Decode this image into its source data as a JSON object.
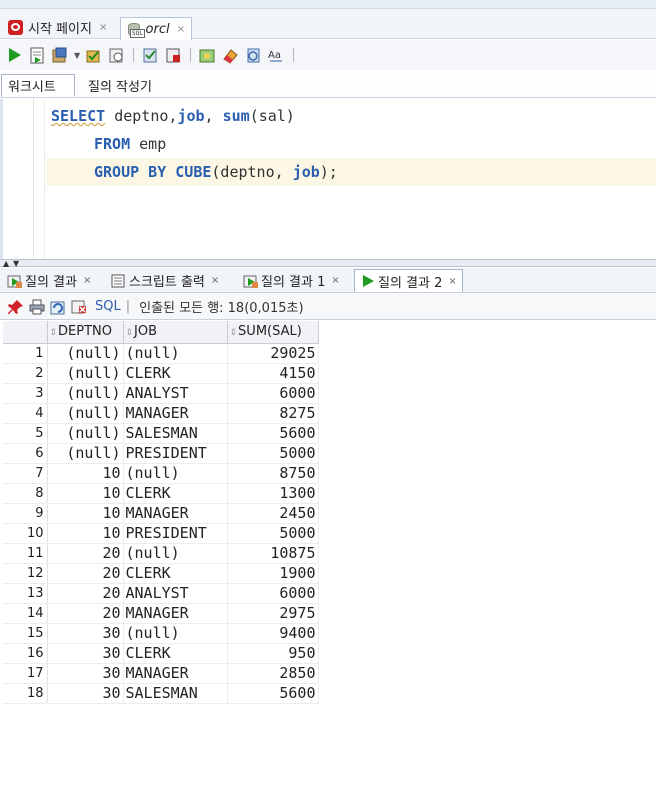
{
  "editor_tabs": [
    {
      "label": "시작 페이지",
      "close": "×"
    },
    {
      "label": "orcl",
      "close": "×"
    }
  ],
  "worksheet_tabs": [
    {
      "label": "워크시트"
    },
    {
      "label": "질의 작성기"
    }
  ],
  "sql": {
    "line1": {
      "kw1": "SELECT",
      "t1": " deptno,",
      "kw2": "job",
      "t2": ", ",
      "kw3": "sum",
      "t3": "(sal)"
    },
    "line2": {
      "kw1": "FROM",
      "t1": " emp"
    },
    "line3": {
      "kw1": "GROUP BY CUBE",
      "t1": "(deptno, ",
      "kw2": "job",
      "t2": ");"
    }
  },
  "result_tabs": [
    {
      "label": "질의 결과",
      "close": "×"
    },
    {
      "label": "스크립트 출력",
      "close": "×"
    },
    {
      "label": "질의 결과 1",
      "close": "×"
    },
    {
      "label": "질의 결과 2",
      "close": "×"
    }
  ],
  "result_toolbar": {
    "sql_label": "SQL",
    "separator": "|",
    "status": "인출된 모든 행: 18(0,015초)"
  },
  "grid": {
    "columns": [
      "DEPTNO",
      "JOB",
      "SUM(SAL)"
    ],
    "rows": [
      {
        "n": "1",
        "deptno": "(null)",
        "job": "(null)",
        "sum": "29025"
      },
      {
        "n": "2",
        "deptno": "(null)",
        "job": "CLERK",
        "sum": "4150"
      },
      {
        "n": "3",
        "deptno": "(null)",
        "job": "ANALYST",
        "sum": "6000"
      },
      {
        "n": "4",
        "deptno": "(null)",
        "job": "MANAGER",
        "sum": "8275"
      },
      {
        "n": "5",
        "deptno": "(null)",
        "job": "SALESMAN",
        "sum": "5600"
      },
      {
        "n": "6",
        "deptno": "(null)",
        "job": "PRESIDENT",
        "sum": "5000"
      },
      {
        "n": "7",
        "deptno": "10",
        "job": "(null)",
        "sum": "8750"
      },
      {
        "n": "8",
        "deptno": "10",
        "job": "CLERK",
        "sum": "1300"
      },
      {
        "n": "9",
        "deptno": "10",
        "job": "MANAGER",
        "sum": "2450"
      },
      {
        "n": "10",
        "deptno": "10",
        "job": "PRESIDENT",
        "sum": "5000"
      },
      {
        "n": "11",
        "deptno": "20",
        "job": "(null)",
        "sum": "10875"
      },
      {
        "n": "12",
        "deptno": "20",
        "job": "CLERK",
        "sum": "1900"
      },
      {
        "n": "13",
        "deptno": "20",
        "job": "ANALYST",
        "sum": "6000"
      },
      {
        "n": "14",
        "deptno": "20",
        "job": "MANAGER",
        "sum": "2975"
      },
      {
        "n": "15",
        "deptno": "30",
        "job": "(null)",
        "sum": "9400"
      },
      {
        "n": "16",
        "deptno": "30",
        "job": "CLERK",
        "sum": "950"
      },
      {
        "n": "17",
        "deptno": "30",
        "job": "MANAGER",
        "sum": "2850"
      },
      {
        "n": "18",
        "deptno": "30",
        "job": "SALESMAN",
        "sum": "5600"
      }
    ]
  },
  "colors": {
    "keyword": "#2a5fb0",
    "run_green": "#1f9b1f",
    "db_red": "#d02020",
    "current_line": "#fbf7e4"
  },
  "icons": [
    "database-connection-icon",
    "sql-worksheet-icon",
    "run-statement-icon",
    "run-script-icon",
    "pin-icon",
    "print-icon",
    "refresh-icon",
    "export-icon"
  ]
}
